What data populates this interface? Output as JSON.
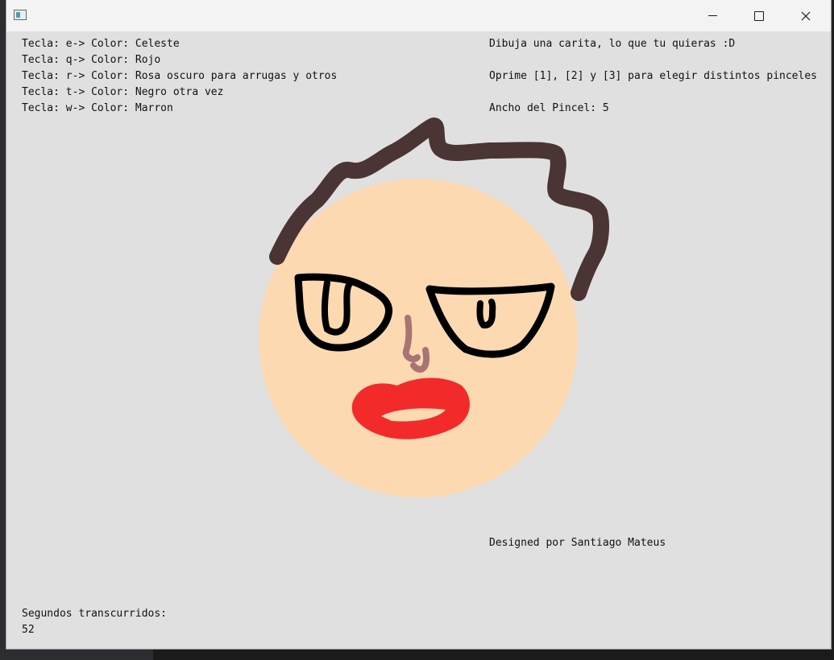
{
  "window": {
    "title": ""
  },
  "colors": {
    "canvas": "#e0e0e0",
    "skin": "#fdd9b2",
    "hair": "#4a3434",
    "eyes": "#000000",
    "nose": "#a87474",
    "lips": "#f22a2a"
  },
  "instructions": {
    "keys": [
      "Tecla: e-> Color: Celeste",
      "Tecla: q-> Color: Rojo",
      "Tecla: r-> Color: Rosa oscuro para arrugas y otros",
      "Tecla: t-> Color: Negro otra vez",
      "Tecla: w-> Color: Marron"
    ],
    "prompt": "Dibuja una carita, lo que tu quieras :D",
    "brush_help": "Oprime [1], [2] y [3] para elegir distintos pinceles",
    "brush_width_label": "Ancho del Pincel: 5"
  },
  "credits": "Designed por Santiago Mateus",
  "timer": {
    "label": "Segundos transcurridos:",
    "value": "52"
  }
}
